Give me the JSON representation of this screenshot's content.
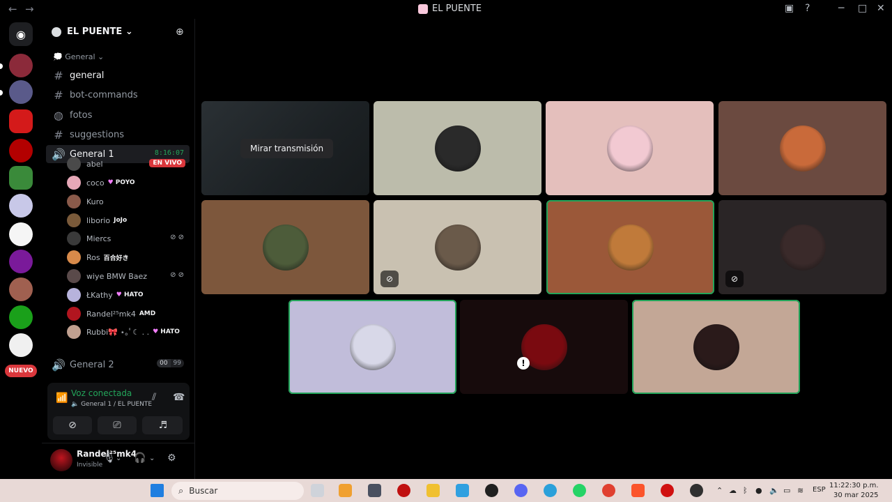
{
  "window": {
    "title": "EL PUENTE",
    "back_icon": "arrow-left",
    "forward_icon": "arrow-right",
    "inbox_icon": "inbox",
    "help_icon": "question-circle",
    "minimize": "─",
    "maximize": "□",
    "close": "✕"
  },
  "rail": {
    "new_badge": "NUEVO"
  },
  "server": {
    "name": "EL PUENTE",
    "category": "General"
  },
  "channels": [
    {
      "label": "general",
      "type": "text"
    },
    {
      "label": "bot-commands",
      "type": "text"
    },
    {
      "label": "fotos",
      "type": "forum"
    },
    {
      "label": "suggestions",
      "type": "text"
    }
  ],
  "voice_channel": {
    "label": "General 1",
    "timer": "8:16:07"
  },
  "members": [
    {
      "name": "abel",
      "tag": "",
      "live": "EN VIVO",
      "color": "#4a4a4a"
    },
    {
      "name": "coco",
      "tag": "POYO",
      "heart": true,
      "color": "#e7a8b8"
    },
    {
      "name": "Kuro",
      "tag": "",
      "color": "#8a5a4a"
    },
    {
      "name": "liborio",
      "tag": "JoJo",
      "color": "#7a5a3a"
    },
    {
      "name": "Miercs",
      "tag": "",
      "muted": true,
      "color": "#3a3a3a"
    },
    {
      "name": "Ros",
      "tag": "百合好き",
      "color": "#d88a4a"
    },
    {
      "name": "wiye BMW Baez",
      "tag": "",
      "muted": true,
      "color": "#5a4a4a"
    },
    {
      "name": "ŁKathy",
      "tag": "HATO",
      "heart": true,
      "color": "#b7b3dc"
    },
    {
      "name": "Randel²⁵mk4",
      "tag": "AMD",
      "color": "#b1151f"
    },
    {
      "name": "Rubbi🎀 ⋆｡ﾟ☾ . .",
      "tag": "HATO",
      "heart": true,
      "color": "#c0a090"
    }
  ],
  "voice_channel_2": {
    "label": "General 2",
    "count_a": "00",
    "count_b": "99"
  },
  "voice_panel": {
    "status": "Voz conectada",
    "location": "General 1 / EL PUENTE"
  },
  "user": {
    "name": "Randel²⁵mk4",
    "status": "Invisible"
  },
  "stream": {
    "watch_label": "Mirar transmisión"
  },
  "tiles": [
    {
      "bg": "#1f2427",
      "stream": true
    },
    {
      "bg": "#bcbcab",
      "av": "#2a2a2a"
    },
    {
      "bg": "#e4bfbc",
      "av": "#f2c9d2"
    },
    {
      "bg": "#6b4a40",
      "av": "#c96a3a"
    },
    {
      "bg": "#7d573c",
      "av": "#4d5c3a"
    },
    {
      "bg": "#c9c1b1",
      "av": "#6a5a4a",
      "cam_off": true
    },
    {
      "bg": "#9b5839",
      "av": "#c07a3a",
      "speaking": true
    },
    {
      "bg": "#2a2526",
      "av": "#3a2a2a",
      "cam_off": true
    },
    {
      "bg": "#c1bdda",
      "av": "#d8d8e8",
      "speaking": true
    },
    {
      "bg": "#170b0c",
      "av": "#7a0a10",
      "warn": true
    },
    {
      "bg": "#c3a796",
      "av": "#2a1a1a",
      "speaking": true
    }
  ],
  "taskbar": {
    "search_placeholder": "Buscar",
    "lang": "ESP",
    "time": "11:22:30 p.m.",
    "date": "30 mar 2025"
  }
}
